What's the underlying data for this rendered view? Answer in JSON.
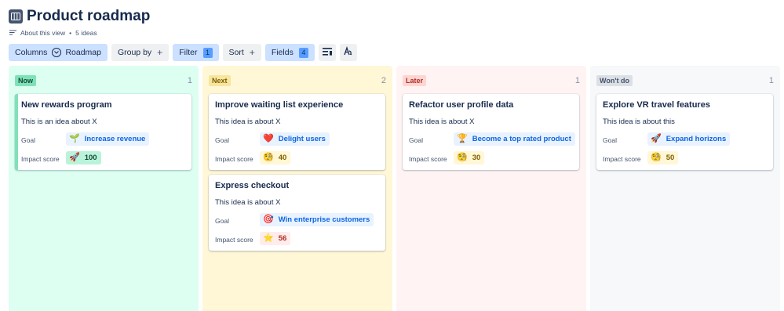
{
  "page": {
    "title": "Product roadmap",
    "about_label": "About this view",
    "separator": "•",
    "ideas_count": "5 ideas"
  },
  "toolbar": {
    "columns_label": "Columns",
    "columns_value": "Roadmap",
    "group_by_label": "Group by",
    "filter_label": "Filter",
    "filter_count": "1",
    "sort_label": "Sort",
    "fields_label": "Fields",
    "fields_count": "4",
    "plus": "+"
  },
  "columns": [
    {
      "name": "Now",
      "count": "1",
      "colors": {
        "bg": "#dcfff1",
        "lozenge_bg": "#7ee2b8",
        "lozenge_text": "#164b35"
      },
      "cards": [
        {
          "title": "New rewards program",
          "description": "This is an idea about X",
          "goal_label": "Goal",
          "goal_icon": "seedling",
          "goal_emoji": "🌱",
          "goal": "Increase revenue",
          "score_label": "Impact score",
          "score_icon": "rocket",
          "score_emoji": "🚀",
          "score": "100",
          "score_color": "#164b35",
          "score_bg": "#baf3db"
        }
      ]
    },
    {
      "name": "Next",
      "count": "2",
      "colors": {
        "bg": "#fff7d6",
        "lozenge_bg": "#f8e6a0",
        "lozenge_text": "#7f5f01"
      },
      "cards": [
        {
          "title": "Improve waiting list experience",
          "description": "This idea is about X",
          "goal_label": "Goal",
          "goal_icon": "heart",
          "goal_emoji": "❤️",
          "goal": "Delight users",
          "score_label": "Impact score",
          "score_icon": "monocle-face",
          "score_emoji": "🧐",
          "score": "40",
          "score_color": "#7f5f01",
          "score_bg": "#fff7d6"
        },
        {
          "title": "Express checkout",
          "description": "This idea is about X",
          "goal_label": "Goal",
          "goal_icon": "target",
          "goal_emoji": "🎯",
          "goal": "Win enterprise customers",
          "score_label": "Impact score",
          "score_icon": "star",
          "score_emoji": "⭐",
          "score": "56",
          "score_color": "#ae2e24",
          "score_bg": "#ffeceb"
        }
      ]
    },
    {
      "name": "Later",
      "count": "1",
      "colors": {
        "bg": "#fff4f3",
        "lozenge_bg": "#ffd5d2",
        "lozenge_text": "#ae2e24"
      },
      "cards": [
        {
          "title": "Refactor user profile data",
          "description": "This idea is about X",
          "goal_label": "Goal",
          "goal_icon": "trophy",
          "goal_emoji": "🏆",
          "goal": "Become a top rated product",
          "score_label": "Impact score",
          "score_icon": "monocle-face",
          "score_emoji": "🧐",
          "score": "30",
          "score_color": "#7f5f01",
          "score_bg": "#fff7d6"
        }
      ]
    },
    {
      "name": "Won't do",
      "count": "1",
      "colors": {
        "bg": "#f7f8f9",
        "lozenge_bg": "#dcdfe4",
        "lozenge_text": "#44546f"
      },
      "cards": [
        {
          "title": "Explore VR travel features",
          "description": "This idea is about this",
          "goal_label": "Goal",
          "goal_icon": "rocket",
          "goal_emoji": "🚀",
          "goal": "Expand horizons",
          "score_label": "Impact score",
          "score_icon": "monocle-face",
          "score_emoji": "🧐",
          "score": "50",
          "score_color": "#7f5f01",
          "score_bg": "#fff7d6"
        }
      ]
    }
  ]
}
